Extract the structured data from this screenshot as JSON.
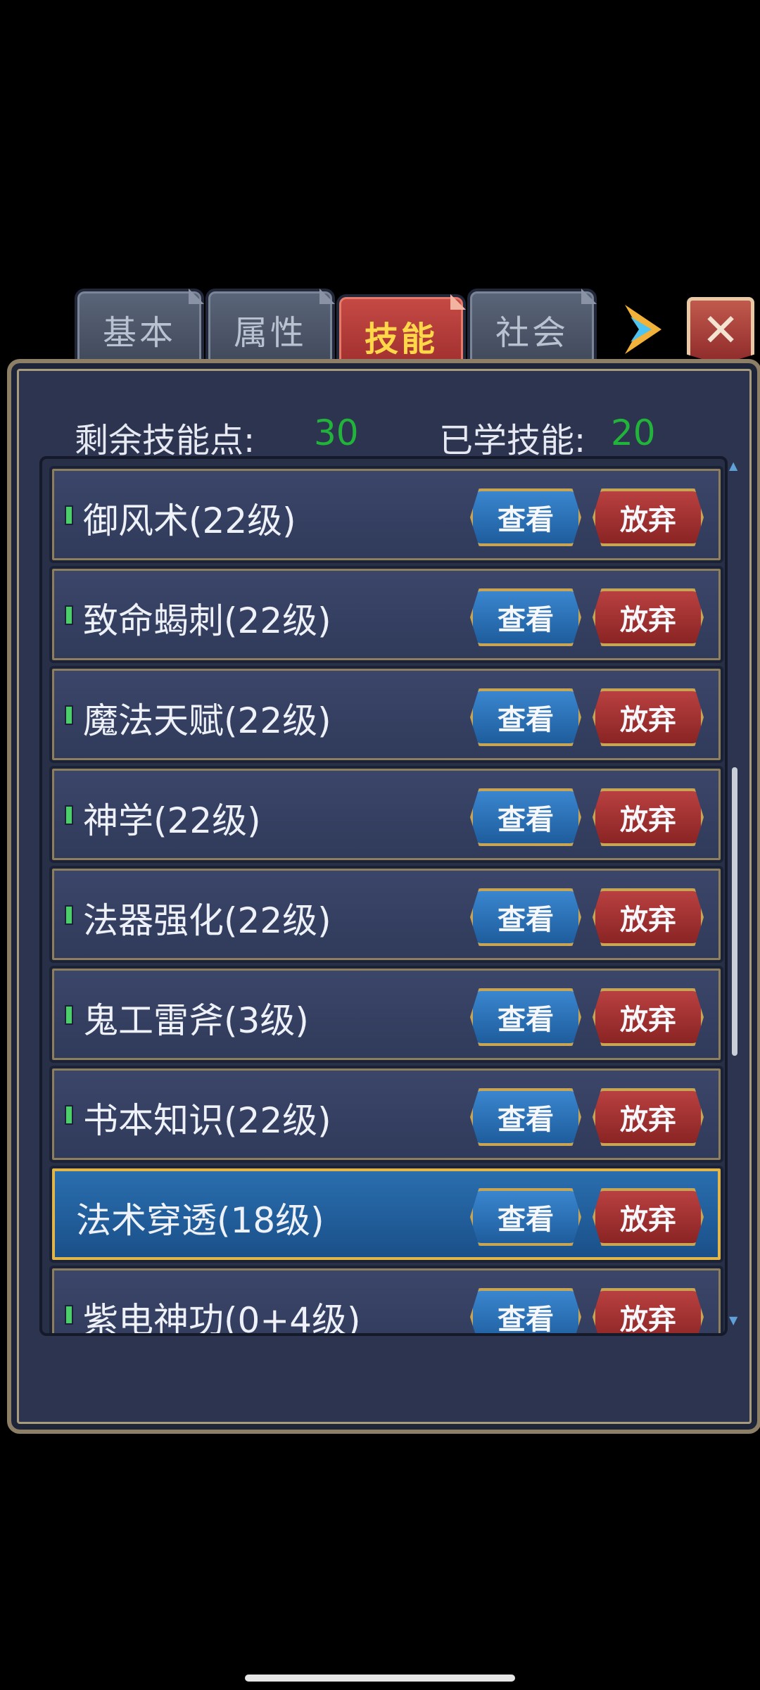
{
  "tabs": [
    {
      "label": "基本"
    },
    {
      "label": "属性"
    },
    {
      "label": "技能"
    },
    {
      "label": "社会"
    }
  ],
  "close_label": "✕",
  "stats": {
    "remaining_label": "剩余技能点:",
    "remaining_value": "30",
    "learned_label": "已学技能:",
    "learned_value": "20"
  },
  "buttons": {
    "view": "查看",
    "drop": "放弃"
  },
  "skills": [
    {
      "name": "御风术(22级)"
    },
    {
      "name": "致命蝎刺(22级)"
    },
    {
      "name": "魔法天赋(22级)"
    },
    {
      "name": "神学(22级)"
    },
    {
      "name": "法器强化(22级)"
    },
    {
      "name": "鬼工雷斧(3级)"
    },
    {
      "name": "书本知识(22级)"
    },
    {
      "name": "法术穿透(18级)"
    },
    {
      "name": "紫电神功(0+4级)"
    }
  ],
  "colors": {
    "accent_green": "#22b33a",
    "active_tab_text": "#ffd84a"
  }
}
